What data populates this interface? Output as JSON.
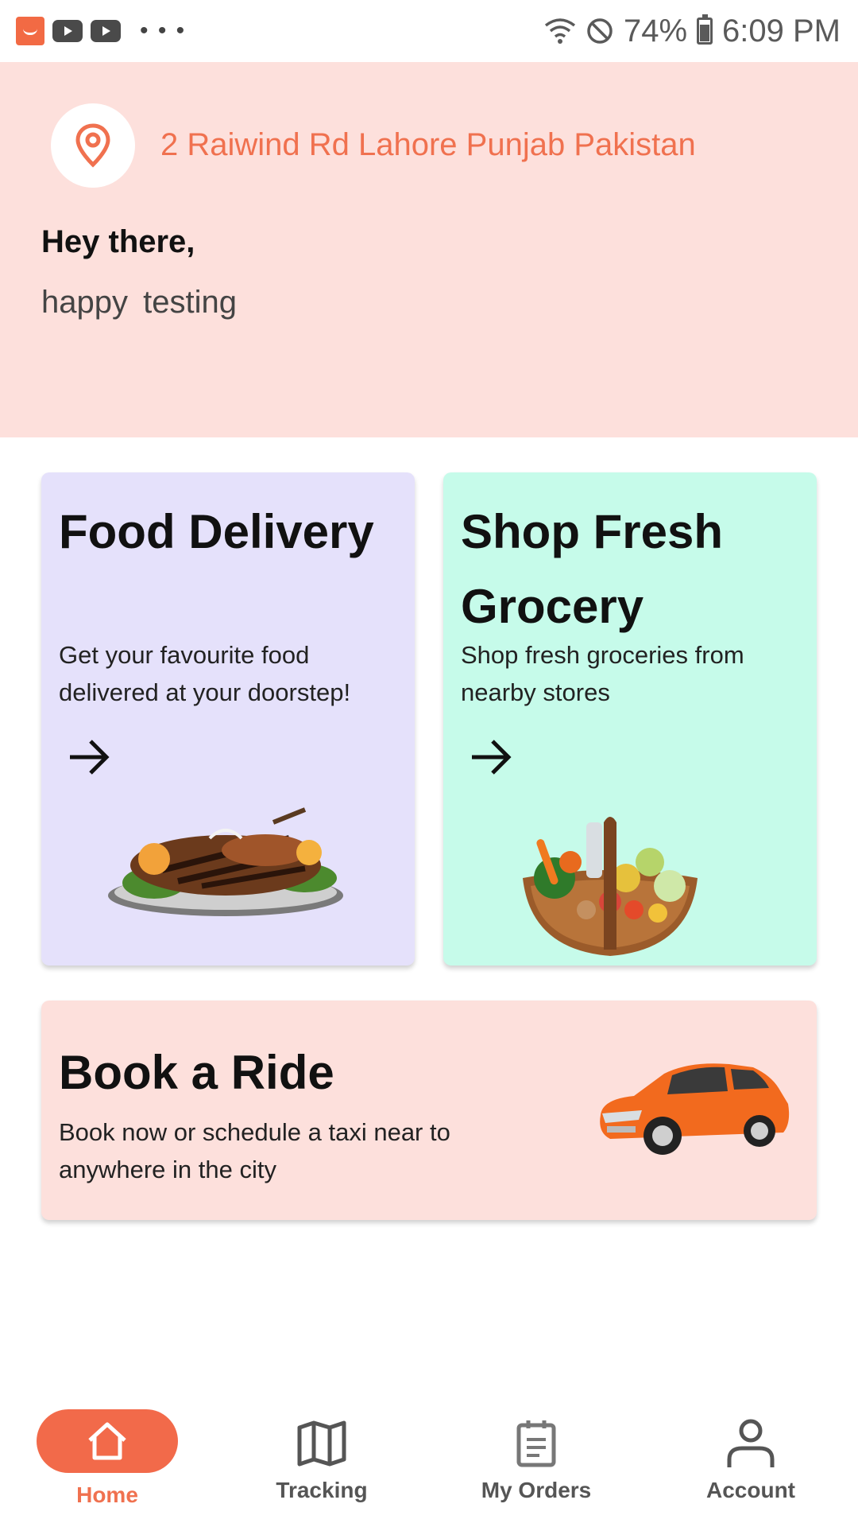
{
  "status_bar": {
    "icons": [
      "app-icon",
      "youtube-icon",
      "youtube-icon",
      "more-icon",
      "wifi-icon",
      "dnd-icon",
      "battery-icon"
    ],
    "more": "• • •",
    "battery_percent": "74%",
    "time": "6:09 PM",
    "battery_level": 0.74
  },
  "header": {
    "location": "2 Raiwind Rd Lahore Punjab Pakistan",
    "greeting": "Hey there,",
    "subtitle": "happy  testing",
    "accent_color": "#f0714f",
    "background_color": "#fde0dc"
  },
  "cards": {
    "food": {
      "title": "Food Delivery",
      "description": "Get your favourite food delivered at your doorstep!",
      "background_color": "#e5e1fb"
    },
    "grocery": {
      "title": "Shop Fresh Grocery",
      "description": "Shop fresh groceries from nearby stores",
      "background_color": "#c6fbea"
    },
    "ride": {
      "title": "Book a Ride",
      "description": "Book now or schedule a taxi near to  anywhere in the city",
      "background_color": "#fde0dc"
    }
  },
  "bottom_nav": {
    "items": [
      {
        "label": "Home",
        "icon": "home-icon",
        "active": true
      },
      {
        "label": "Tracking",
        "icon": "map-icon",
        "active": false
      },
      {
        "label": "My Orders",
        "icon": "clipboard-icon",
        "active": false
      },
      {
        "label": "Account",
        "icon": "user-icon",
        "active": false
      }
    ],
    "active_color": "#f26a4a"
  }
}
